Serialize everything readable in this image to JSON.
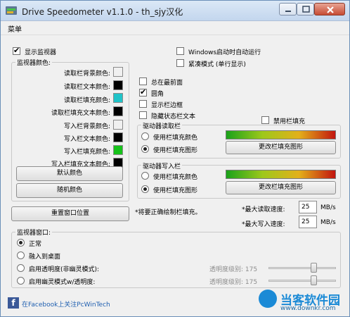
{
  "window": {
    "title": "Drive Speedometer v1.1.0 - th_sjy汉化"
  },
  "menu": {
    "items": [
      "菜单"
    ]
  },
  "show_monitor": {
    "label": "显示监视器",
    "checked": true
  },
  "colors_group": {
    "title": "监视器颜色:",
    "rows": [
      {
        "label": "读取栏背景颜色:",
        "color": "#f0f0f0"
      },
      {
        "label": "读取栏文本颜色:",
        "color": "#000000"
      },
      {
        "label": "读取栏填充颜色:",
        "color": "#1fc3c8"
      },
      {
        "label": "读取栏填充文本颜色:",
        "color": "#000000"
      },
      {
        "label": "写入栏背景颜色:",
        "color": "#f0f0f0"
      },
      {
        "label": "写入栏文本颜色:",
        "color": "#000000"
      },
      {
        "label": "写入栏填充颜色:",
        "color": "#16c21a"
      },
      {
        "label": "写入栏填充文本颜色:",
        "color": "#000000"
      }
    ],
    "default_button": "默认颜色",
    "random_button": "随机颜色"
  },
  "reset_position_button": "重置窗口位置",
  "startup": {
    "label": "Windows启动时自动运行",
    "checked": false
  },
  "compact": {
    "label": "紧凑模式 (单行显示)",
    "checked": false
  },
  "options": [
    {
      "label": "总在最前面",
      "checked": false
    },
    {
      "label": "圆角",
      "checked": true
    },
    {
      "label": "显示栏边框",
      "checked": false
    },
    {
      "label": "隐藏状态栏文本",
      "checked": false
    }
  ],
  "disable_fill": {
    "label": "禁用栏填充",
    "checked": false
  },
  "read_bar_group": {
    "title": "驱动器读取栏",
    "option_color": "使用栏填充颜色",
    "option_image": "使用栏填充图形",
    "selected": "image",
    "change_button": "更改栏填充图形"
  },
  "write_bar_group": {
    "title": "驱动器写入栏",
    "option_color": "使用栏填充颜色",
    "option_image": "使用栏填充图形",
    "selected": "image",
    "change_button": "更改栏填充图形"
  },
  "note": "*将要正确绘制栏填充。",
  "max_read": {
    "label": "*最大读取速度:",
    "value": "25",
    "unit": "MB/s"
  },
  "max_write": {
    "label": "*最大写入速度:",
    "value": "25",
    "unit": "MB/s"
  },
  "monitor_window": {
    "title": "监视器窗口:",
    "options": [
      "正常",
      "融入到桌面",
      "启用透明度(非幽灵模式):",
      "启用幽灵模式w/透明度:"
    ],
    "selected_index": 0,
    "transparency_label_1": "透明度级别: 175",
    "transparency_label_2": "透明度级别: 175",
    "transparency_level_1": 175,
    "transparency_level_2": 175,
    "transparency_max": 255
  },
  "footer": {
    "facebook_text": "在Facebook上关注PcWinTech"
  },
  "watermark": {
    "title": "当客软件园",
    "url": "www.downkr.com"
  }
}
